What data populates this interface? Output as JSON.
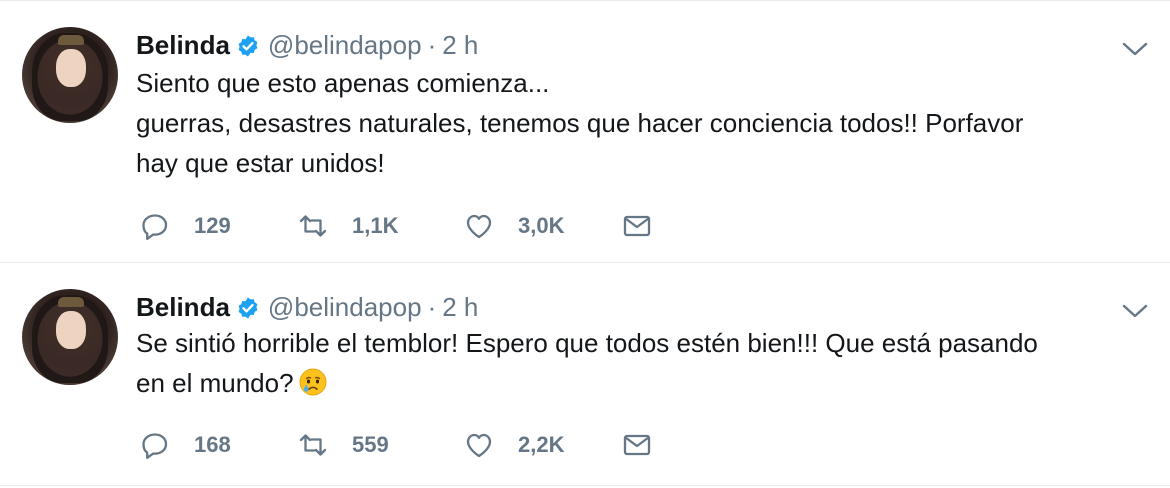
{
  "tweets": [
    {
      "name": "Belinda",
      "handle": "@belindapop",
      "separator": "·",
      "time": "2 h",
      "lines": [
        "Siento que esto apenas comienza...",
        "guerras, desastres naturales, tenemos que hacer conciencia todos!! Porfavor",
        "hay que estar unidos!"
      ],
      "replies": "129",
      "retweets": "1,1K",
      "likes": "3,0K"
    },
    {
      "name": "Belinda",
      "handle": "@belindapop",
      "separator": "·",
      "time": "2 h",
      "lines": [
        "Se sintió horrible el temblor! Espero que todos estén bien!!! Que está pasando",
        "en el mundo?"
      ],
      "emoji": "crying-face-emoji",
      "replies": "168",
      "retweets": "559",
      "likes": "2,2K"
    }
  ],
  "colors": {
    "text": "#14171a",
    "secondary": "#657786",
    "verified": "#1da1f2",
    "border": "#e6ecf0"
  },
  "icons": [
    "verified-badge-icon",
    "chevron-down-icon",
    "reply-icon",
    "retweet-icon",
    "like-icon",
    "direct-message-icon"
  ]
}
